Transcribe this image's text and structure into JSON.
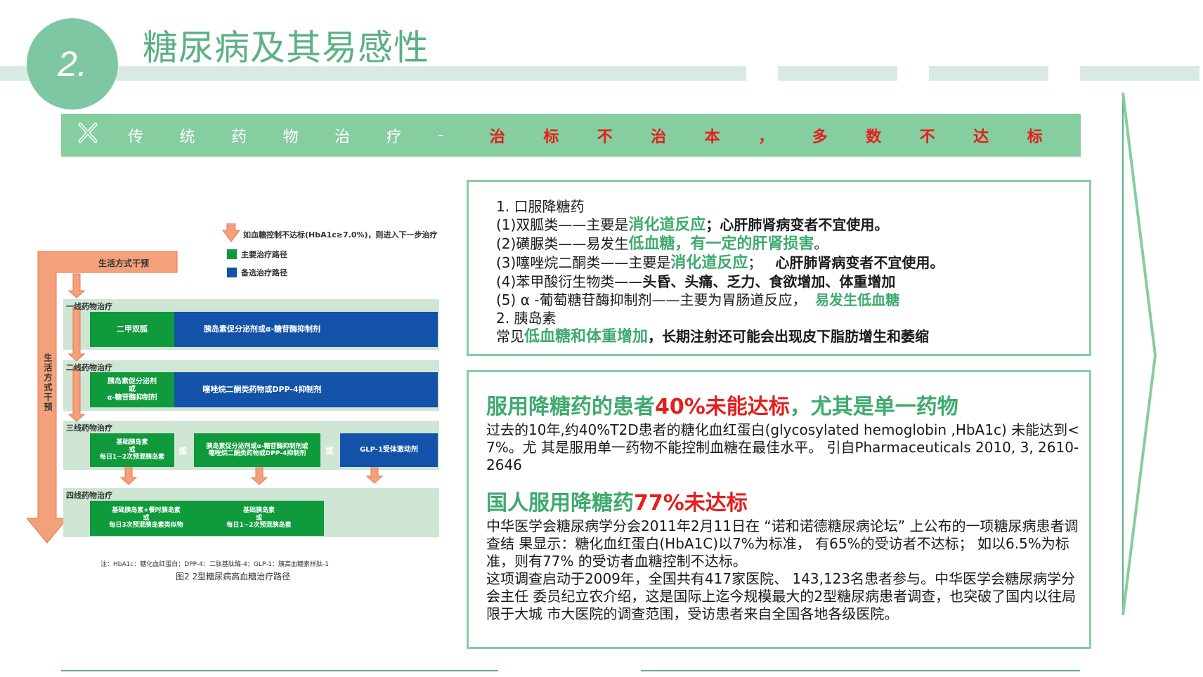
{
  "header": {
    "number": "2.",
    "title": "糖尿病及其易感性"
  },
  "banner": {
    "white_chars": [
      "传",
      "统",
      "药",
      "物",
      "治",
      "疗",
      "-"
    ],
    "red_chars": [
      "治",
      "标",
      "不",
      "治",
      "本",
      "，",
      "多",
      "数",
      "不",
      "达",
      "标"
    ]
  },
  "chart": {
    "legend_top": "如血糖控制不达标(HbA1c≥7.0%)，则进入下一步治疗",
    "legend_main": "主要治疗路径",
    "legend_alt": "备选治疗路径",
    "lifestyle_box": "生活方式干预",
    "lifestyle_vertical": "生活方式干预",
    "line1_label": "一线药物治疗",
    "line1_green": "二甲双胍",
    "line1_blue": "胰岛素促分泌剂或α-糖苷酶抑制剂",
    "line2_label": "二线药物治疗",
    "line2_green": "胰岛素促分泌剂\n或\nα-糖苷酶抑制剂",
    "line2_blue": "噻唑烷二酮类药物或DPP-4抑制剂",
    "line3_label": "三线药物治疗",
    "line3_green": "基础胰岛素\n或\n每日1~2次预混胰岛素",
    "line3_or1": "或",
    "line3_mid": "胰岛素促分泌剂或α-糖苷酶抑制剂或\n噻唑烷二酮类药物或DPP-4抑制剂",
    "line3_or2": "或",
    "line3_right": "GLP-1受体激动剂",
    "line4_label": "四线药物治疗",
    "line4_left": "基础胰岛素+餐时胰岛素\n或\n每日3次预混胰岛素类似物",
    "line4_mid": "基础胰岛素\n或\n每日1~2次预混胰岛素",
    "note": "注：HbA1c：糖化血红蛋白；DPP-4：二肽基肽酶-4；GLP-1：胰高血糖素样肽-1",
    "caption": "图2  2型糖尿病高血糖治疗路径"
  },
  "box1": {
    "l1": "1. 口服降糖药",
    "l2_a": "(1)双胍类——主要是",
    "l2_g": "消化道反应",
    "l2_b": "；心肝肺肾病变者不宜使用。",
    "l3_a": "(2)磺脲类——易发生",
    "l3_g": "低血糖，有一定的肝肾损害",
    "l3_c": "。",
    "l4_a": "(3)噻唑烷二酮类——主要是",
    "l4_g": "消化道反应",
    "l4_c": "；",
    "l4_b": "心肝肺肾病变者不宜使用。",
    "l5_a": "(4)苯甲酸衍生物类——",
    "l5_b": "头昏、头痛、乏力、食欲增加、体重增加",
    "l6_a": "(5) α -葡萄糖苷酶抑制剂——主要为胃肠道反应，",
    "l6_g": "易发生低血糖",
    "l7": "2. 胰岛素",
    "l8_a": "常见",
    "l8_g": "低血糖和体重增加",
    "l8_b": "，长期注射还可能会出现皮下脂肪增生和萎缩"
  },
  "box2": {
    "h1_a": "服用降糖药的患者",
    "h1_r": "40%未能达标",
    "h1_b": "，尤其是单一药物",
    "p1": "过去的10年,约40%T2D患者的糖化血红蛋白(glycosylated hemoglobin ,HbA1c) 未能达到< 7%。尤  其是服用单一药物不能控制血糖在最佳水平。     引自Pharmaceuticals 2010, 3, 2610-2646",
    "h2_a": "国人服用降糖药",
    "h2_r": "77%未达标",
    "p2": "中华医学会糖尿病学分会2011年2月11日在 “诺和诺德糖尿病论坛” 上公布的一项糖尿病患者调查结      果显示：糖化血红蛋白(HbA1C)以7%为标准，  有65%的受访者不达标；   如以6.5%为标准，则有77%  的受访者血糖控制不达标。",
    "p3": "这项调查启动于2009年，全国共有417家医院、  143,123名患者参与。中华医学会糖尿病学分会主任      委员纪立农介绍，这是国际上迄今规模最大的2型糖尿病患者调查，也突破了国内以往局限于大城      市大医院的调查范围，受访患者来自全国各地各级医院。"
  },
  "colors": {
    "green_main": "#86cda0",
    "green_text": "#3faa6e",
    "red": "#e2201c",
    "chart_green": "#0f9a3c",
    "chart_blue": "#1252a8",
    "chart_orange": "#f4a07a"
  }
}
